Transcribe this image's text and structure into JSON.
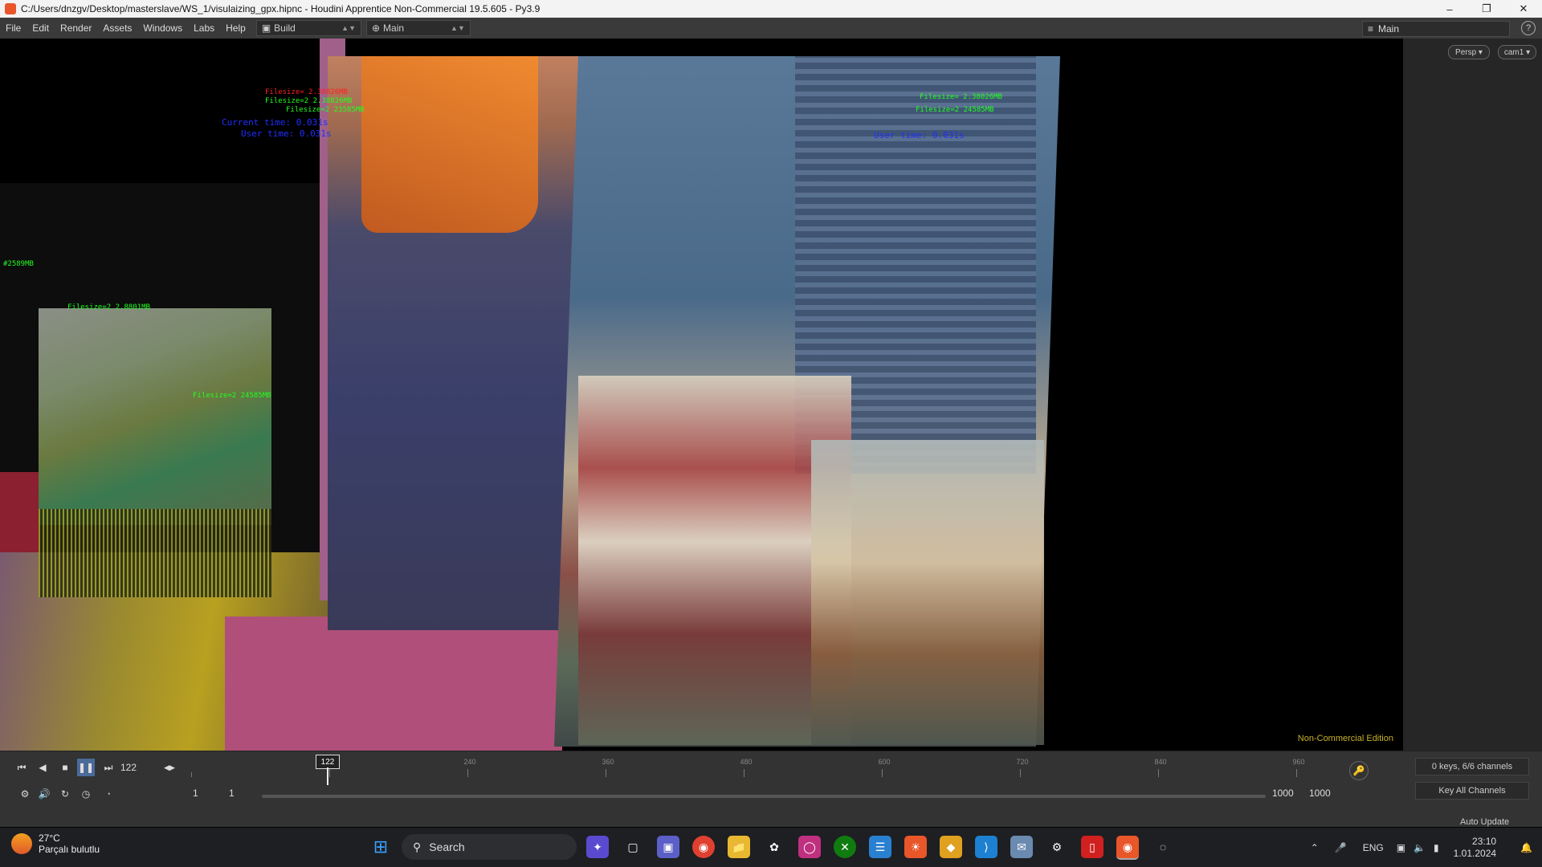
{
  "window": {
    "title": "C:/Users/dnzgv/Desktop/masterslave/WS_1/visulaizing_gpx.hipnc - Houdini Apprentice Non-Commercial 19.5.605 - Py3.9"
  },
  "menubar": {
    "items": [
      "File",
      "Edit",
      "Render",
      "Assets",
      "Windows",
      "Labs",
      "Help"
    ],
    "desktop_build": "Build",
    "desktop_main": "Main",
    "right_desktop": "Main"
  },
  "viewport": {
    "camera_persp": "Persp ▾",
    "camera_cam": "cam1 ▾",
    "edition_label": "Non-Commercial Edition",
    "annotations": {
      "a1": "Filesize= 2.38826MB",
      "a2": "Filesize=2 2.38826MB",
      "a3": "Filesize=2 23585MB",
      "a4": "Current time: 0.031s",
      "a5": "User time: 0.031s",
      "b1": "Filesize= 2.38026MB",
      "b2": "Filesize=2 24585MB",
      "b3": "User time: 0.031s",
      "c1": "Filesize=2 2.8801MB",
      "c2": "#2589MB",
      "c3": "Filesize=2 24585MB"
    }
  },
  "timeline": {
    "current_frame": "122",
    "marker": "122",
    "tick_labels": [
      "240",
      "360",
      "480",
      "600",
      "720",
      "840",
      "960"
    ],
    "range_start": "1",
    "range_start2": "1",
    "range_end": "1000",
    "range_end2": "1000",
    "keys_channels": "0 keys, 6/6 channels",
    "key_all_channels": "Key All Channels",
    "auto_update": "Auto Update"
  },
  "taskbar": {
    "weather_temp": "27°C",
    "weather_desc": "Parçalı bulutlu",
    "search_label": "Search",
    "language": "ENG",
    "time": "23:10",
    "date": "1.01.2024"
  },
  "colors": {
    "edition": "#c8b22a",
    "anno_red": "#ff2020",
    "anno_green": "#20ff20",
    "anno_blue": "#2030ff"
  }
}
